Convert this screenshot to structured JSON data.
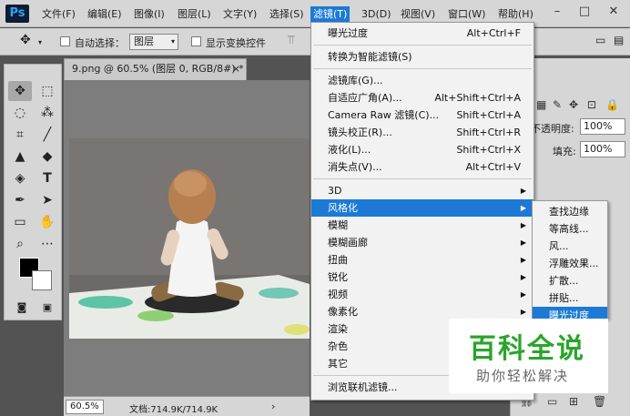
{
  "app": {
    "logo": "Ps"
  },
  "menubar": {
    "items": [
      "文件(F)",
      "编辑(E)",
      "图像(I)",
      "图层(L)",
      "文字(Y)",
      "选择(S)",
      "滤镜(T)",
      "3D(D)",
      "视图(V)",
      "窗口(W)",
      "帮助(H)"
    ],
    "active_index": 6
  },
  "window_controls": {
    "minimize": "–",
    "maximize": "□",
    "close": "✕"
  },
  "options": {
    "auto_select_label": "自动选择：",
    "auto_select_value": "图层",
    "show_transform_label": "显示变换控件"
  },
  "document": {
    "tab_title": "9.png @ 60.5% (图层 0, RGB/8#) *",
    "tab_close": "×",
    "zoom": "60.5%",
    "info": "文档:714.9K/714.9K",
    "info_arrow": "›"
  },
  "right_panel": {
    "opacity_label": "不透明度:",
    "opacity_value": "100%",
    "fill_label": "填充:",
    "fill_value": "100%"
  },
  "filter_menu": {
    "items": [
      {
        "label": "曝光过度",
        "shortcut": "Alt+Ctrl+F"
      },
      {
        "sep": true
      },
      {
        "label": "转换为智能滤镜(S)"
      },
      {
        "sep": true
      },
      {
        "label": "滤镜库(G)..."
      },
      {
        "label": "自适应广角(A)...",
        "shortcut": "Alt+Shift+Ctrl+A"
      },
      {
        "label": "Camera Raw 滤镜(C)...",
        "shortcut": "Shift+Ctrl+A"
      },
      {
        "label": "镜头校正(R)...",
        "shortcut": "Shift+Ctrl+R"
      },
      {
        "label": "液化(L)...",
        "shortcut": "Shift+Ctrl+X"
      },
      {
        "label": "消失点(V)...",
        "shortcut": "Alt+Ctrl+V"
      },
      {
        "sep": true
      },
      {
        "label": "3D",
        "submenu": true
      },
      {
        "label": "风格化",
        "submenu": true,
        "highlighted": true
      },
      {
        "label": "模糊",
        "submenu": true
      },
      {
        "label": "模糊画廊",
        "submenu": true
      },
      {
        "label": "扭曲",
        "submenu": true
      },
      {
        "label": "锐化",
        "submenu": true
      },
      {
        "label": "视频",
        "submenu": true
      },
      {
        "label": "像素化",
        "submenu": true
      },
      {
        "label": "渲染",
        "submenu": true
      },
      {
        "label": "杂色",
        "submenu": true
      },
      {
        "label": "其它",
        "submenu": true
      },
      {
        "sep": true
      },
      {
        "label": "浏览联机滤镜..."
      }
    ]
  },
  "stylize_submenu": {
    "items": [
      {
        "label": "查找边缘"
      },
      {
        "label": "等高线..."
      },
      {
        "label": "风..."
      },
      {
        "label": "浮雕效果..."
      },
      {
        "label": "扩散..."
      },
      {
        "label": "拼贴..."
      },
      {
        "label": "曝光过度",
        "highlighted": true
      }
    ]
  },
  "watermark": {
    "title": "百科全说",
    "subtitle": "助你轻松解决"
  },
  "colors": {
    "accent": "#1c7ad6",
    "ps_blue": "#2fa3f2",
    "watermark_green": "#2aa52a"
  }
}
